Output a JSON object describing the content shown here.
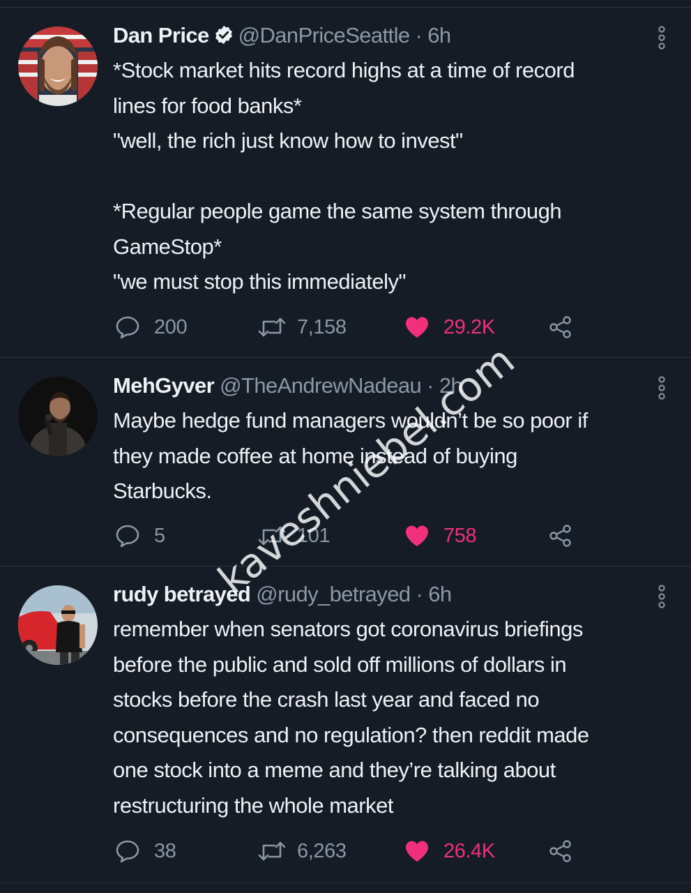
{
  "colors": {
    "background": "#151c26",
    "text": "#eef2f5",
    "secondary": "#8b98a5",
    "like": "#f0317a",
    "divider": "#2b3440"
  },
  "tweets": [
    {
      "name": "Dan Price",
      "verified": true,
      "handle": "@DanPriceSeattle",
      "separator": "·",
      "time": "6h",
      "lines": [
        "*Stock market hits record highs at a time of record",
        "lines for food banks*",
        "\"well, the rich just know how to invest\"",
        "",
        "*Regular people game the same system through",
        "GameStop*",
        "\"we must stop this immediately\""
      ],
      "replies": "200",
      "retweets": "7,158",
      "likes": "29.2K",
      "liked": true
    },
    {
      "name": "MehGyver",
      "verified": false,
      "handle": "@TheAndrewNadeau",
      "separator": "·",
      "time": "2h",
      "lines": [
        "Maybe hedge fund managers wouldn’t be so poor if",
        "they made coffee at home instead of buying",
        "Starbucks."
      ],
      "replies": "5",
      "retweets": "101",
      "likes": "758",
      "liked": true
    },
    {
      "name": "rudy betrayed",
      "verified": false,
      "handle": "@rudy_betrayed",
      "separator": "·",
      "time": "6h",
      "lines": [
        "remember when senators got coronavirus briefings",
        "before the public and sold off millions of dollars in",
        "stocks before the crash last year and faced no",
        "consequences and no regulation? then reddit made",
        "one stock into a meme and they’re talking about",
        "restructuring the whole market"
      ],
      "replies": "38",
      "retweets": "6,263",
      "likes": "26.4K",
      "liked": true
    }
  ],
  "icons": {
    "reply": "reply-icon",
    "retweet": "retweet-icon",
    "like": "heart-icon",
    "share": "share-icon",
    "menu": "more-vertical-icon",
    "verified": "verified-badge-icon"
  },
  "watermark": "kaveshniebel.com"
}
